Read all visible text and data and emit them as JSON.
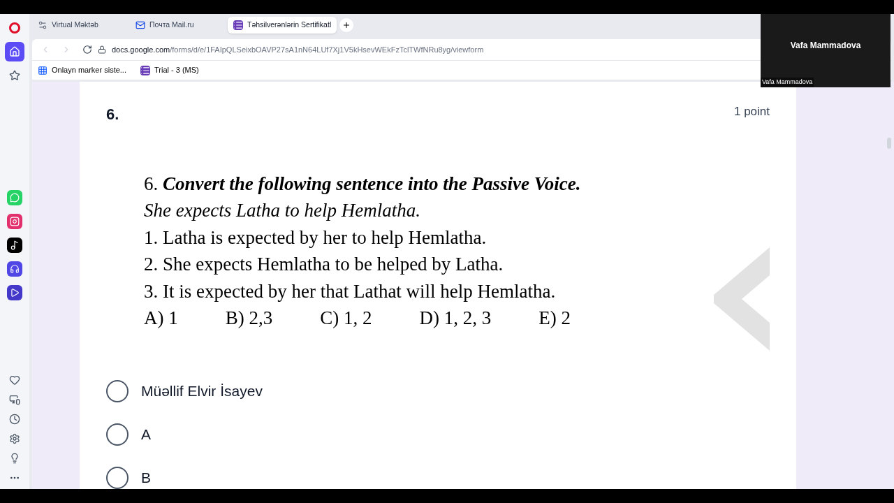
{
  "tabs": [
    {
      "label": "Virtual Məktəb",
      "selected": false
    },
    {
      "label": "Почта Mail.ru",
      "selected": false
    },
    {
      "label": "Təhsilverənlərin Sertifikatl",
      "selected": true
    }
  ],
  "address_bar": {
    "host": "docs.google.com",
    "path": "/forms/d/e/1FAIpQLSeixbOAVP27sA1nN64LUf7Xj1V5kHsevWEkFzTclTWfNRu8yg/viewform"
  },
  "bookmarks": [
    {
      "label": "Onlayn marker siste..."
    },
    {
      "label": "Trial - 3 (MS)"
    }
  ],
  "sidebar": {
    "apps": [
      {
        "kind": "whatsapp"
      },
      {
        "kind": "instagram"
      },
      {
        "kind": "tiktok"
      },
      {
        "kind": "music"
      },
      {
        "kind": "player"
      }
    ]
  },
  "question": {
    "number": "6.",
    "points": "1 point",
    "image_lines": [
      {
        "kind": "title",
        "number": "6.",
        "text": "Convert the following sentence into the Passive Voice."
      },
      {
        "kind": "italic",
        "text": "She expects Latha to help Hemlatha."
      },
      {
        "kind": "plain",
        "text": "1. Latha is expected by her to help Hemlatha."
      },
      {
        "kind": "plain",
        "text": "2. She expects Hemlatha to be helped by Latha."
      },
      {
        "kind": "plain",
        "text": "3. It is expected by her that Lathat will help Hemlatha."
      }
    ],
    "image_choices": [
      "A) 1",
      "B) 2,3",
      "C) 1, 2",
      "D) 1, 2, 3",
      "E) 2"
    ],
    "options": [
      {
        "label": "Müəllif Elvir İsayev",
        "selected": false
      },
      {
        "label": "A",
        "selected": false
      },
      {
        "label": "B",
        "selected": false
      }
    ]
  },
  "video_tile": {
    "name": "Vafa Mammadova",
    "caption": "Vafa Mammadova"
  }
}
